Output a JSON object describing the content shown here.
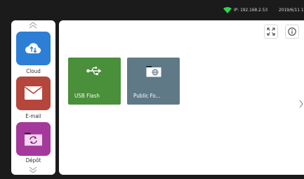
{
  "status_bar": {
    "ip_text": "IP: 192.168.2.53",
    "datetime_text": "2019/6/11 1",
    "wifi_color": "#2bd84a"
  },
  "sidebar": {
    "scroll_up_icon": "double-chevron-up-icon",
    "scroll_down_icon": "double-chevron-down-icon",
    "apps": [
      {
        "label": "Cloud",
        "icon": "cloud-sync-icon",
        "color": "#2d7fd6"
      },
      {
        "label": "E-mail",
        "icon": "envelope-icon",
        "color": "#b4463c"
      },
      {
        "label": "Dépôt",
        "icon": "folder-sync-icon",
        "color": "#a5389b"
      }
    ]
  },
  "main": {
    "controls": [
      {
        "icon": "expand-icon"
      },
      {
        "icon": "info-icon"
      }
    ],
    "tiles": [
      {
        "label": "USB Flash",
        "icon": "usb-icon",
        "color": "#4a8f3a"
      },
      {
        "label": "Public Fo...",
        "icon": "network-folder-icon",
        "color": "#5f7a86"
      }
    ],
    "edge_icon": "chevron-right-icon"
  }
}
